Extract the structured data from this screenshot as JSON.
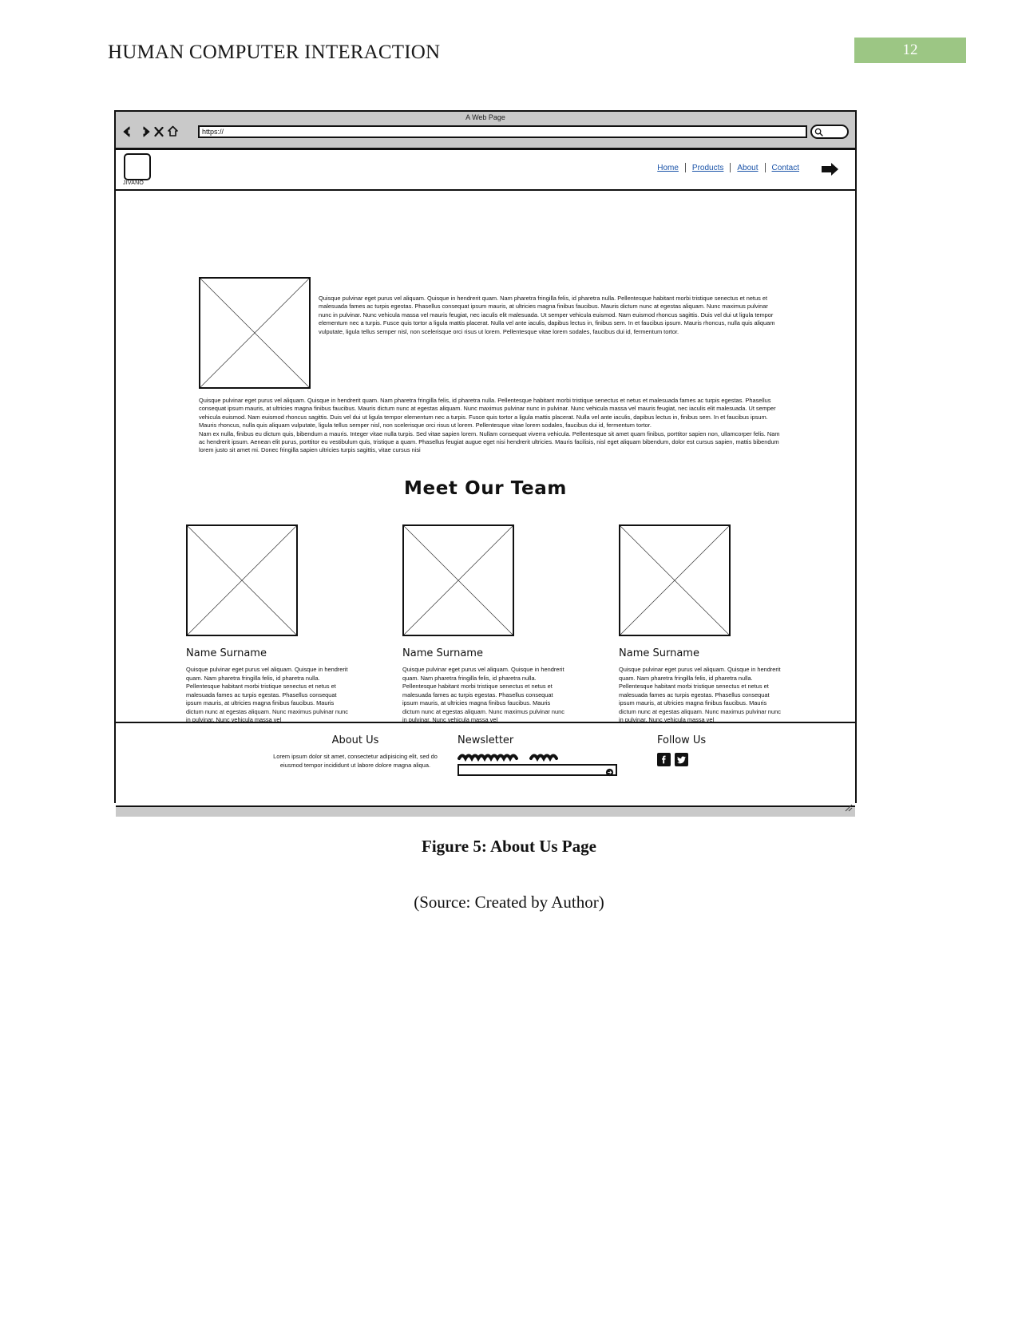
{
  "document": {
    "header_title": "HUMAN COMPUTER INTERACTION",
    "page_number": "12",
    "header_badge_color": "#9cc684",
    "figure_caption": "Figure 5: About Us Page",
    "source_caption": "(Source: Created by Author)"
  },
  "browser": {
    "window_title": "A Web Page",
    "url_value": "https://",
    "url_placeholder": "https://",
    "back_icon": "back-arrow-icon",
    "forward_icon": "forward-arrow-icon",
    "stop_icon": "close-x-icon",
    "home_icon": "home-icon",
    "search_icon": "search-icon"
  },
  "site_nav": {
    "logo_text": "JIVANO",
    "links": [
      {
        "label": "Home"
      },
      {
        "label": "Products"
      },
      {
        "label": "About"
      },
      {
        "label": "Contact"
      }
    ],
    "login_icon": "login-arrow-icon",
    "link_color": "#1a53a8"
  },
  "hero": {
    "image_placeholder": "image-placeholder",
    "paragraph": "Quisque pulvinar eget purus vel aliquam. Quisque in hendrerit quam. Nam pharetra fringilla felis, id pharetra nulla. Pellentesque habitant morbi tristique senectus et netus et malesuada fames ac turpis egestas. Phasellus consequat ipsum mauris, at ultricies magna finibus faucibus. Mauris dictum nunc at egestas aliquam. Nunc maximus pulvinar nunc in pulvinar. Nunc vehicula massa vel mauris feugiat, nec iaculis elit malesuada. Ut semper vehicula euismod. Nam euismod rhoncus sagittis. Duis vel dui ut ligula tempor elementum nec a turpis. Fusce quis tortor a ligula mattis placerat. Nulla vel ante iaculis, dapibus lectus in, finibus sem. In et faucibus ipsum. Mauris rhoncus, nulla quis aliquam vulputate, ligula tellus semper nisl, non scelerisque orci risus ut lorem. Pellentesque vitae lorem sodales, faucibus dui id, fermentum tortor."
  },
  "main_body": {
    "paragraph_1": "Quisque pulvinar eget purus vel aliquam. Quisque in hendrerit quam. Nam pharetra fringilla felis, id pharetra nulla. Pellentesque habitant morbi tristique senectus et netus et malesuada fames ac turpis egestas. Phasellus consequat ipsum mauris, at ultricies magna finibus faucibus. Mauris dictum nunc at egestas aliquam. Nunc maximus pulvinar nunc in pulvinar. Nunc vehicula massa vel mauris feugiat, nec iaculis elit malesuada. Ut semper vehicula euismod. Nam euismod rhoncus sagittis. Duis vel dui ut ligula tempor elementum nec a turpis. Fusce quis tortor a ligula mattis placerat. Nulla vel ante iaculis, dapibus lectus in, finibus sem. In et faucibus ipsum. Mauris rhoncus, nulla quis aliquam vulputate, ligula tellus semper nisl, non scelerisque orci risus ut lorem. Pellentesque vitae lorem sodales, faucibus dui id, fermentum tortor.",
    "paragraph_2": "Nam ex nulla, finibus eu dictum quis, bibendum a mauris. Integer vitae nulla turpis. Sed vitae sapien lorem. Nullam consequat viverra vehicula. Pellentesque sit amet quam finibus, porttitor sapien non, ullamcorper felis. Nam ac hendrerit ipsum. Aenean elit purus, porttitor eu vestibulum quis, tristique a quam. Phasellus feugiat augue eget nisi hendrerit ultricies. Mauris facilisis, nisl eget aliquam bibendum, dolor est cursus sapien, mattis bibendum lorem justo sit amet mi. Donec fringilla sapien ultricies turpis sagittis, vitae cursus nisi"
  },
  "team": {
    "heading": "Meet Our Team",
    "members": [
      {
        "photo_placeholder": "image-placeholder",
        "name": "Name Surname",
        "bio": "Quisque pulvinar eget purus vel aliquam. Quisque in hendrerit quam. Nam pharetra fringilla felis, id pharetra nulla. Pellentesque habitant morbi tristique senectus et netus et malesuada fames ac turpis egestas. Phasellus consequat ipsum mauris, at ultricies magna finibus faucibus. Mauris dictum nunc at egestas aliquam. Nunc maximus pulvinar nunc in pulvinar. Nunc vehicula massa vel"
      },
      {
        "photo_placeholder": "image-placeholder",
        "name": "Name Surname",
        "bio": "Quisque pulvinar eget purus vel aliquam. Quisque in hendrerit quam. Nam pharetra fringilla felis, id pharetra nulla. Pellentesque habitant morbi tristique senectus et netus et malesuada fames ac turpis egestas. Phasellus consequat ipsum mauris, at ultricies magna finibus faucibus. Mauris dictum nunc at egestas aliquam. Nunc maximus pulvinar nunc in pulvinar. Nunc vehicula massa vel"
      },
      {
        "photo_placeholder": "image-placeholder",
        "name": "Name Surname",
        "bio": "Quisque pulvinar eget purus vel aliquam. Quisque in hendrerit quam. Nam pharetra fringilla felis, id pharetra nulla. Pellentesque habitant morbi tristique senectus et netus et malesuada fames ac turpis egestas. Phasellus consequat ipsum mauris, at ultricies magna finibus faucibus. Mauris dictum nunc at egestas aliquam. Nunc maximus pulvinar nunc in pulvinar. Nunc vehicula massa vel"
      }
    ]
  },
  "footer": {
    "about": {
      "title": "About Us",
      "body": "Lorem ipsum dolor sit amet, consectetur adipisicing elit, sed do eiusmod tempor incididunt ut labore dolore magna aliqua."
    },
    "newsletter": {
      "title": "Newsletter",
      "input_value": "",
      "input_placeholder": "",
      "submit_icon": "submit-arrow-icon"
    },
    "follow": {
      "title": "Follow Us",
      "socials": [
        {
          "icon": "facebook-icon"
        },
        {
          "icon": "twitter-icon"
        }
      ]
    }
  }
}
